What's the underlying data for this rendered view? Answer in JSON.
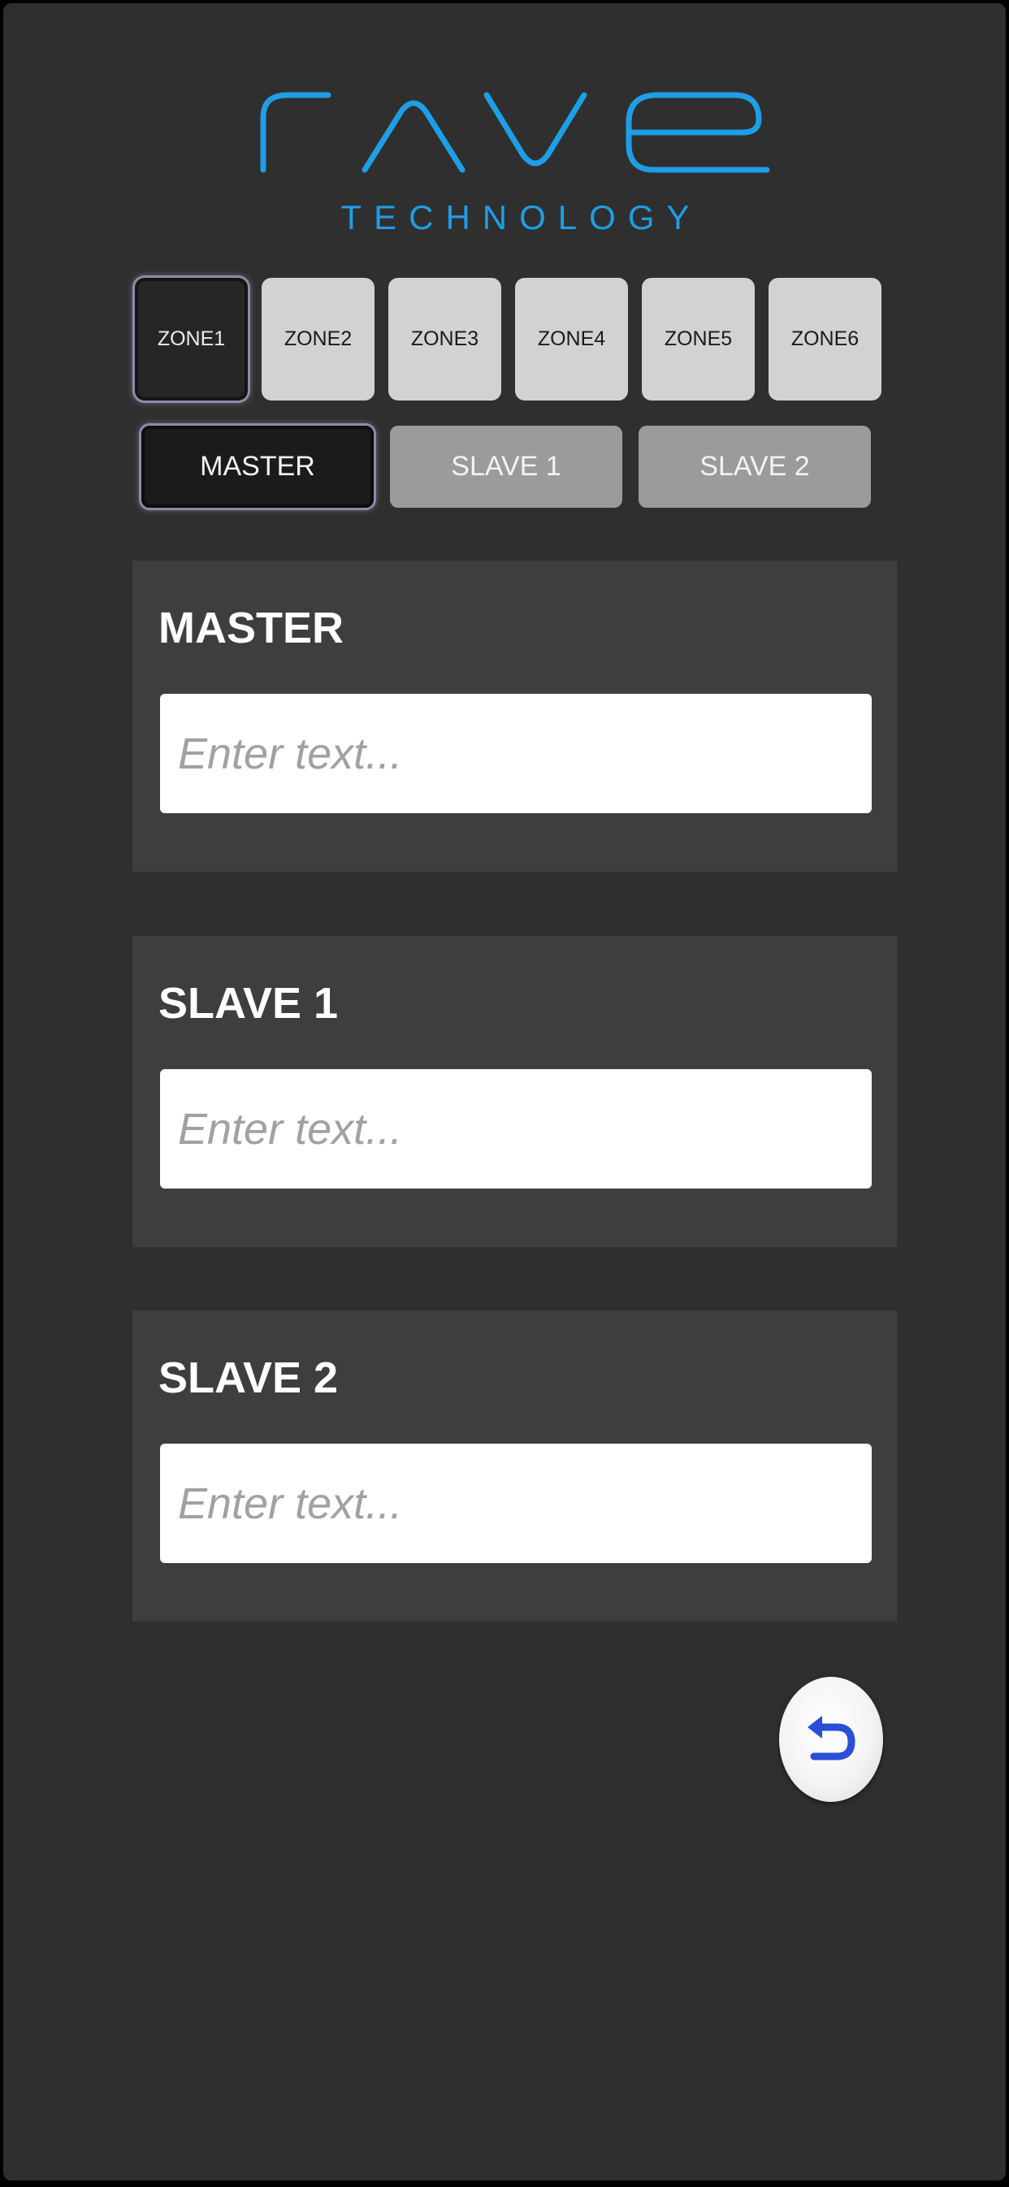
{
  "brand": {
    "name": "rave",
    "tagline": "TECHNOLOGY",
    "accent_color": "#1e9ee6"
  },
  "zones": [
    {
      "label": "ZONE1",
      "active": true
    },
    {
      "label": "ZONE2",
      "active": false
    },
    {
      "label": "ZONE3",
      "active": false
    },
    {
      "label": "ZONE4",
      "active": false
    },
    {
      "label": "ZONE5",
      "active": false
    },
    {
      "label": "ZONE6",
      "active": false
    }
  ],
  "roles": [
    {
      "label": "MASTER",
      "active": true
    },
    {
      "label": "SLAVE 1",
      "active": false
    },
    {
      "label": "SLAVE 2",
      "active": false
    }
  ],
  "panels": [
    {
      "title": "MASTER",
      "value": "",
      "placeholder": "Enter text..."
    },
    {
      "title": "SLAVE 1",
      "value": "",
      "placeholder": "Enter text..."
    },
    {
      "title": "SLAVE 2",
      "value": "",
      "placeholder": "Enter text..."
    }
  ],
  "back_button": {
    "icon": "undo-arrow-icon",
    "icon_color": "#2a4ed8"
  }
}
